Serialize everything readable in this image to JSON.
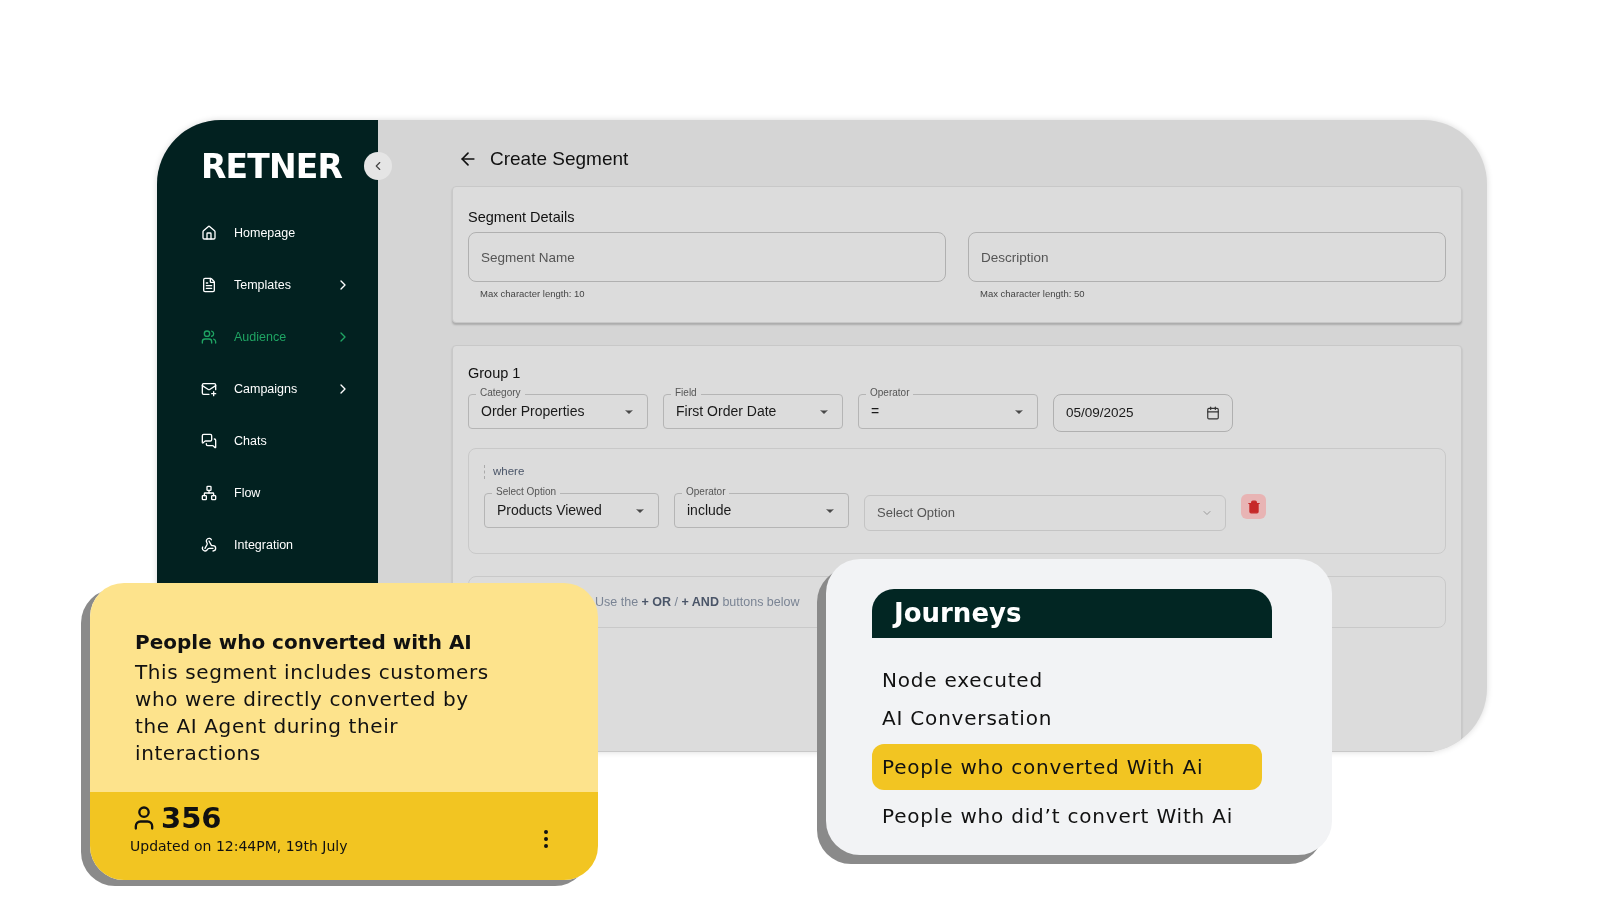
{
  "sidebar": {
    "logo": "RETNER",
    "items": [
      {
        "label": "Homepage",
        "selected": false,
        "chevron": false
      },
      {
        "label": "Templates",
        "selected": false,
        "chevron": true
      },
      {
        "label": "Audience",
        "selected": true,
        "chevron": true
      },
      {
        "label": "Campaigns",
        "selected": false,
        "chevron": true
      },
      {
        "label": "Chats",
        "selected": false,
        "chevron": false
      },
      {
        "label": "Flow",
        "selected": false,
        "chevron": false
      },
      {
        "label": "Integration",
        "selected": false,
        "chevron": false
      }
    ]
  },
  "page": {
    "title": "Create Segment",
    "details": {
      "title": "Segment Details",
      "fields": [
        {
          "placeholder": "Segment Name",
          "hint": "Max character length: 10"
        },
        {
          "placeholder": "Description",
          "hint": "Max character length: 50"
        }
      ]
    },
    "group": {
      "title": "Group 1",
      "selects": [
        {
          "label": "Category",
          "value": "Order Properties"
        },
        {
          "label": "Field",
          "value": "First Order Date"
        },
        {
          "label": "Operator",
          "value": "="
        }
      ],
      "date": "05/09/2025",
      "where": {
        "label": "where",
        "selects": [
          {
            "label": "Select Option",
            "value": "Products Viewed"
          },
          {
            "label": "Operator",
            "value": "include"
          }
        ],
        "option_placeholder": "Select Option"
      },
      "hint": "Use the **+ OR** / **+ AND** buttons below"
    }
  },
  "segment_card": {
    "title": "People who converted with AI",
    "description": "This segment includes customers who were directly converted by the AI Agent during their interactions",
    "count": "356",
    "updated": "Updated on 12:44PM, 19th July"
  },
  "journeys": {
    "title": "Journeys",
    "items": [
      {
        "label": "Node executed",
        "selected": false
      },
      {
        "label": "AI Conversation",
        "selected": false
      },
      {
        "label": "People who converted With Ai",
        "selected": true
      },
      {
        "label": "People who did’t convert With Ai",
        "selected": false
      }
    ]
  }
}
